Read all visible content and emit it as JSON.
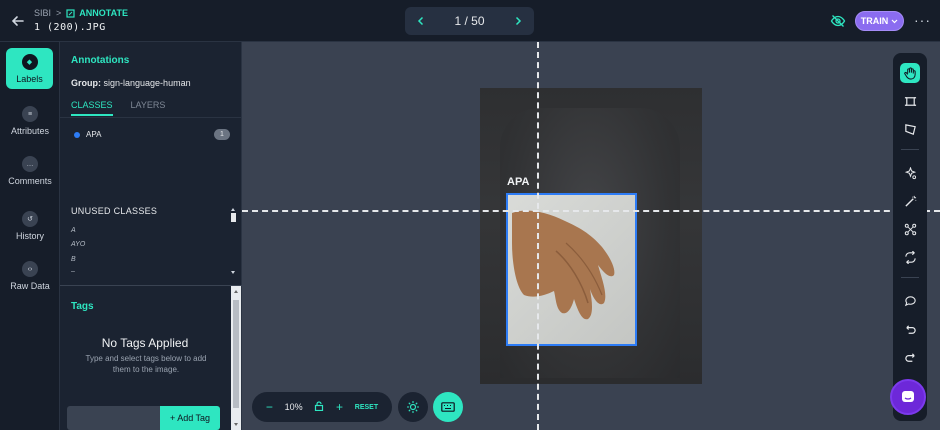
{
  "header": {
    "breadcrumb_project": "SIBI",
    "breadcrumb_separator": ">",
    "breadcrumb_section": "ANNOTATE",
    "filename": "1 (200).JPG",
    "pager": {
      "current": "1 / 50"
    },
    "train_label": "TRAIN",
    "more_label": "···"
  },
  "rail": {
    "items": [
      {
        "label": "Labels",
        "icon": "tag-icon"
      },
      {
        "label": "Attributes",
        "icon": "list-icon"
      },
      {
        "label": "Comments",
        "icon": "comment-icon"
      },
      {
        "label": "History",
        "icon": "history-icon"
      },
      {
        "label": "Raw Data",
        "icon": "code-icon"
      }
    ]
  },
  "panel": {
    "title": "Annotations",
    "group_label": "Group:",
    "group_value": "sign-language-human",
    "tabs": [
      "CLASSES",
      "LAYERS"
    ],
    "classes": [
      {
        "name": "APA",
        "count": "1",
        "color": "#2d7cf6"
      }
    ],
    "unused_title": "UNUSED CLASSES",
    "unused_items": [
      "A",
      "AYO",
      "B",
      "–"
    ],
    "tags_title": "Tags",
    "no_tags_title": "No Tags Applied",
    "no_tags_sub": "Type and select tags below to add them to the image.",
    "add_tag_label": "+ Add Tag"
  },
  "canvas": {
    "box_label": "APA"
  },
  "zoom": {
    "minus": "−",
    "value": "10%",
    "plus": "+",
    "reset": "RESET"
  },
  "colors": {
    "accent": "#2ee6c1",
    "train": "#8b6cf0",
    "box": "#2d7cf6"
  }
}
